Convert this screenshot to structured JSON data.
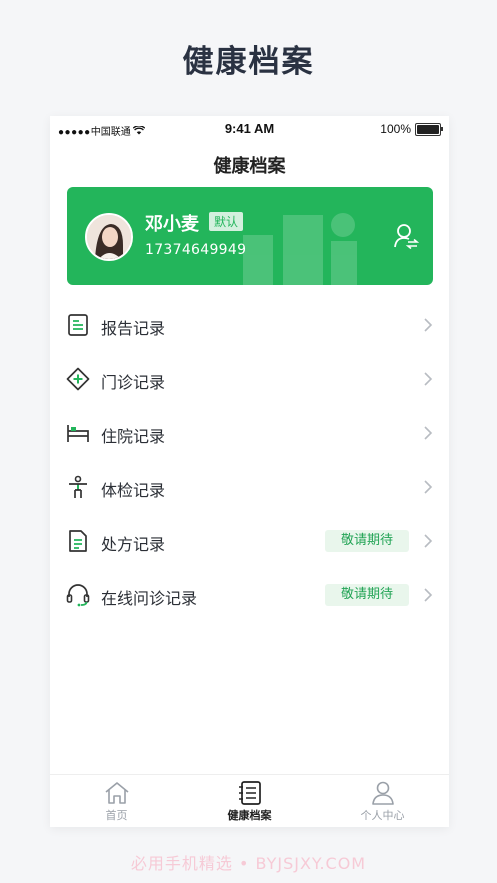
{
  "page_heading": "健康档案",
  "status_bar": {
    "carrier": "中国联通",
    "time": "9:41 AM",
    "battery": "100%"
  },
  "nav": {
    "title": "健康档案"
  },
  "profile": {
    "name": "邓小麦",
    "badge": "默认",
    "phone": "17374649949"
  },
  "menu": [
    {
      "label": "报告记录",
      "icon": "report-icon"
    },
    {
      "label": "门诊记录",
      "icon": "outpatient-icon"
    },
    {
      "label": "住院记录",
      "icon": "hospital-bed-icon"
    },
    {
      "label": "体检记录",
      "icon": "body-check-icon"
    },
    {
      "label": "处方记录",
      "icon": "prescription-icon",
      "badge": "敬请期待"
    },
    {
      "label": "在线问诊记录",
      "icon": "headset-icon",
      "badge": "敬请期待"
    }
  ],
  "tabs": [
    {
      "label": "首页",
      "icon": "home-icon"
    },
    {
      "label": "健康档案",
      "icon": "health-record-icon",
      "active": true
    },
    {
      "label": "个人中心",
      "icon": "user-icon"
    }
  ],
  "colors": {
    "accent": "#23b55b",
    "badge_bg": "#e9f6ec"
  },
  "watermark": "必用手机精选 • BYJSJXY.COM"
}
